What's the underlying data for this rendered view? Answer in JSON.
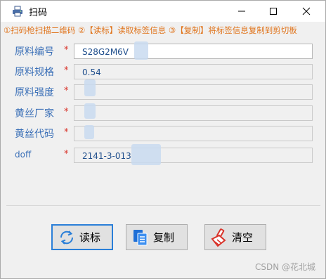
{
  "window": {
    "title": "扫码"
  },
  "hint": "①扫码枪扫描二维码 ②【读标】读取标签信息 ③【复制】将标签信息复制到剪切板",
  "fields": [
    {
      "label": "原料编号",
      "value": "S28G2M6V"
    },
    {
      "label": "原料规格",
      "value": "0.54"
    },
    {
      "label": "原料强度",
      "value": ""
    },
    {
      "label": "黄丝厂家",
      "value": ""
    },
    {
      "label": "黄丝代码",
      "value": ""
    },
    {
      "label": "doff",
      "value": "2141-3-013"
    }
  ],
  "required_mark": "*",
  "buttons": {
    "read": "读标",
    "copy": "复制",
    "clear": "清空"
  },
  "watermark": "CSDN @花北城",
  "colors": {
    "label": "#3a6fb7",
    "required": "#d9342b",
    "hint": "#e0741c",
    "focus": "#2a7fd8"
  }
}
